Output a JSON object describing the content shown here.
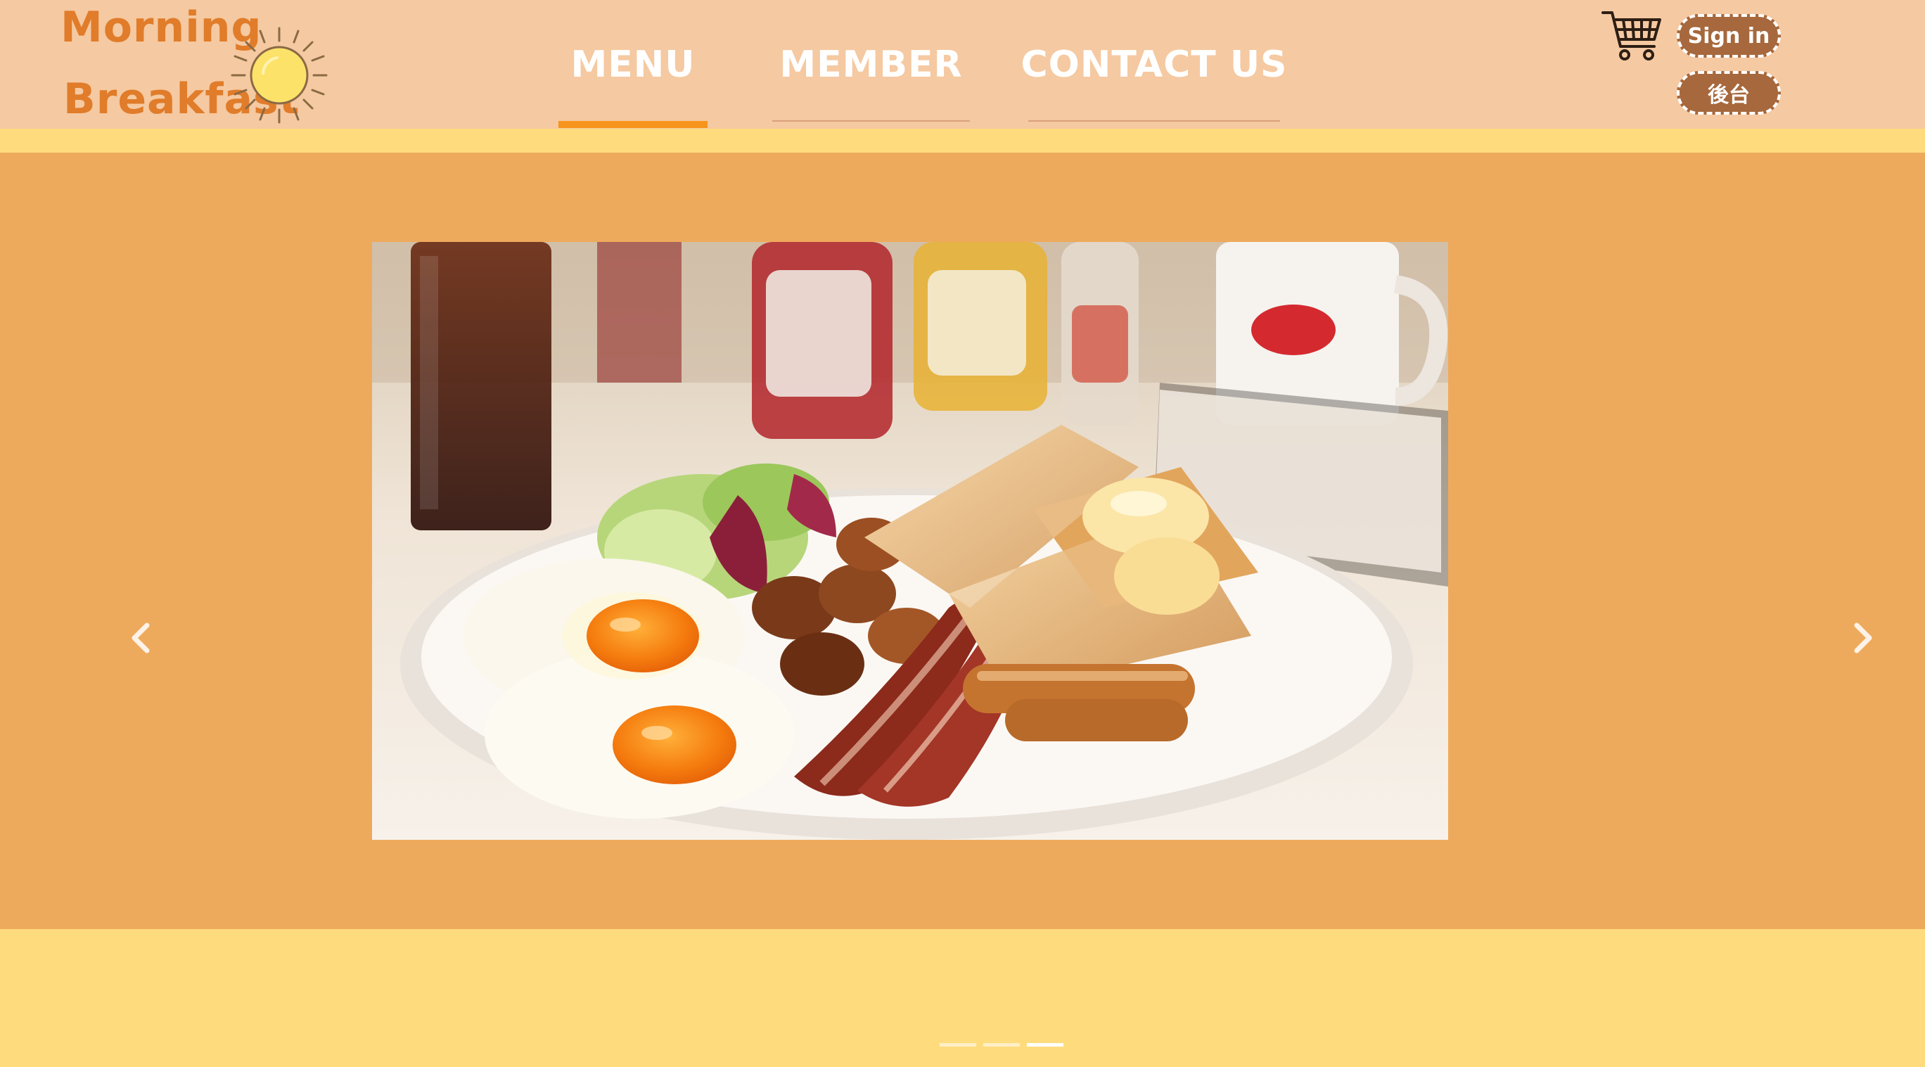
{
  "brand": {
    "line1": "Morning",
    "line2": "Breakfast",
    "icon": "sun-icon",
    "color": "#e07c2a"
  },
  "nav": {
    "items": [
      {
        "label": "MENU",
        "active": true
      },
      {
        "label": "MEMBER",
        "active": false
      },
      {
        "label": "CONTACT US",
        "active": false
      }
    ],
    "active_underline_color": "#f7941d"
  },
  "header_actions": {
    "cart_icon": "shopping-cart-icon",
    "sign_in_label": "Sign in",
    "backend_label": "後台",
    "button_color": "#a6683c"
  },
  "carousel": {
    "slide_image": "breakfast-plate-photo",
    "prev_icon": "chevron-left-icon",
    "next_icon": "chevron-right-icon",
    "indicator_count": 3,
    "active_indicator": 3,
    "background": "#eeaa5c"
  },
  "colors": {
    "header_bg": "#f5c9a1",
    "strip_bg": "#fedc7e"
  }
}
